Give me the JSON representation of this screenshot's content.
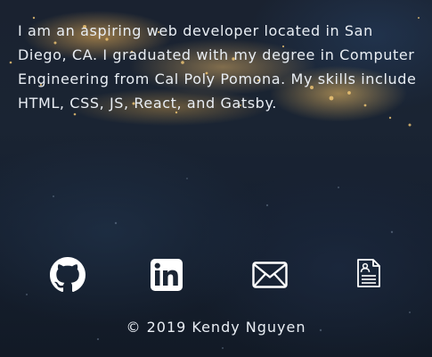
{
  "about": {
    "bio": "I am an aspiring web developer located in San Diego, CA. I graduated with my degree in Computer Engineering from Cal Poly Pomona. My skills include HTML, CSS, JS, React, and Gatsby."
  },
  "social_links": [
    {
      "name": "github",
      "icon": "github-icon"
    },
    {
      "name": "linkedin",
      "icon": "linkedin-icon"
    },
    {
      "name": "email",
      "icon": "envelope-icon"
    },
    {
      "name": "resume",
      "icon": "resume-document-icon"
    }
  ],
  "footer": {
    "copyright": "© 2019 Kendy Nguyen"
  },
  "colors": {
    "text": "#e9eef4",
    "icon": "#ffffff",
    "background": "#1a2433",
    "city_lights": "#ffc870"
  }
}
